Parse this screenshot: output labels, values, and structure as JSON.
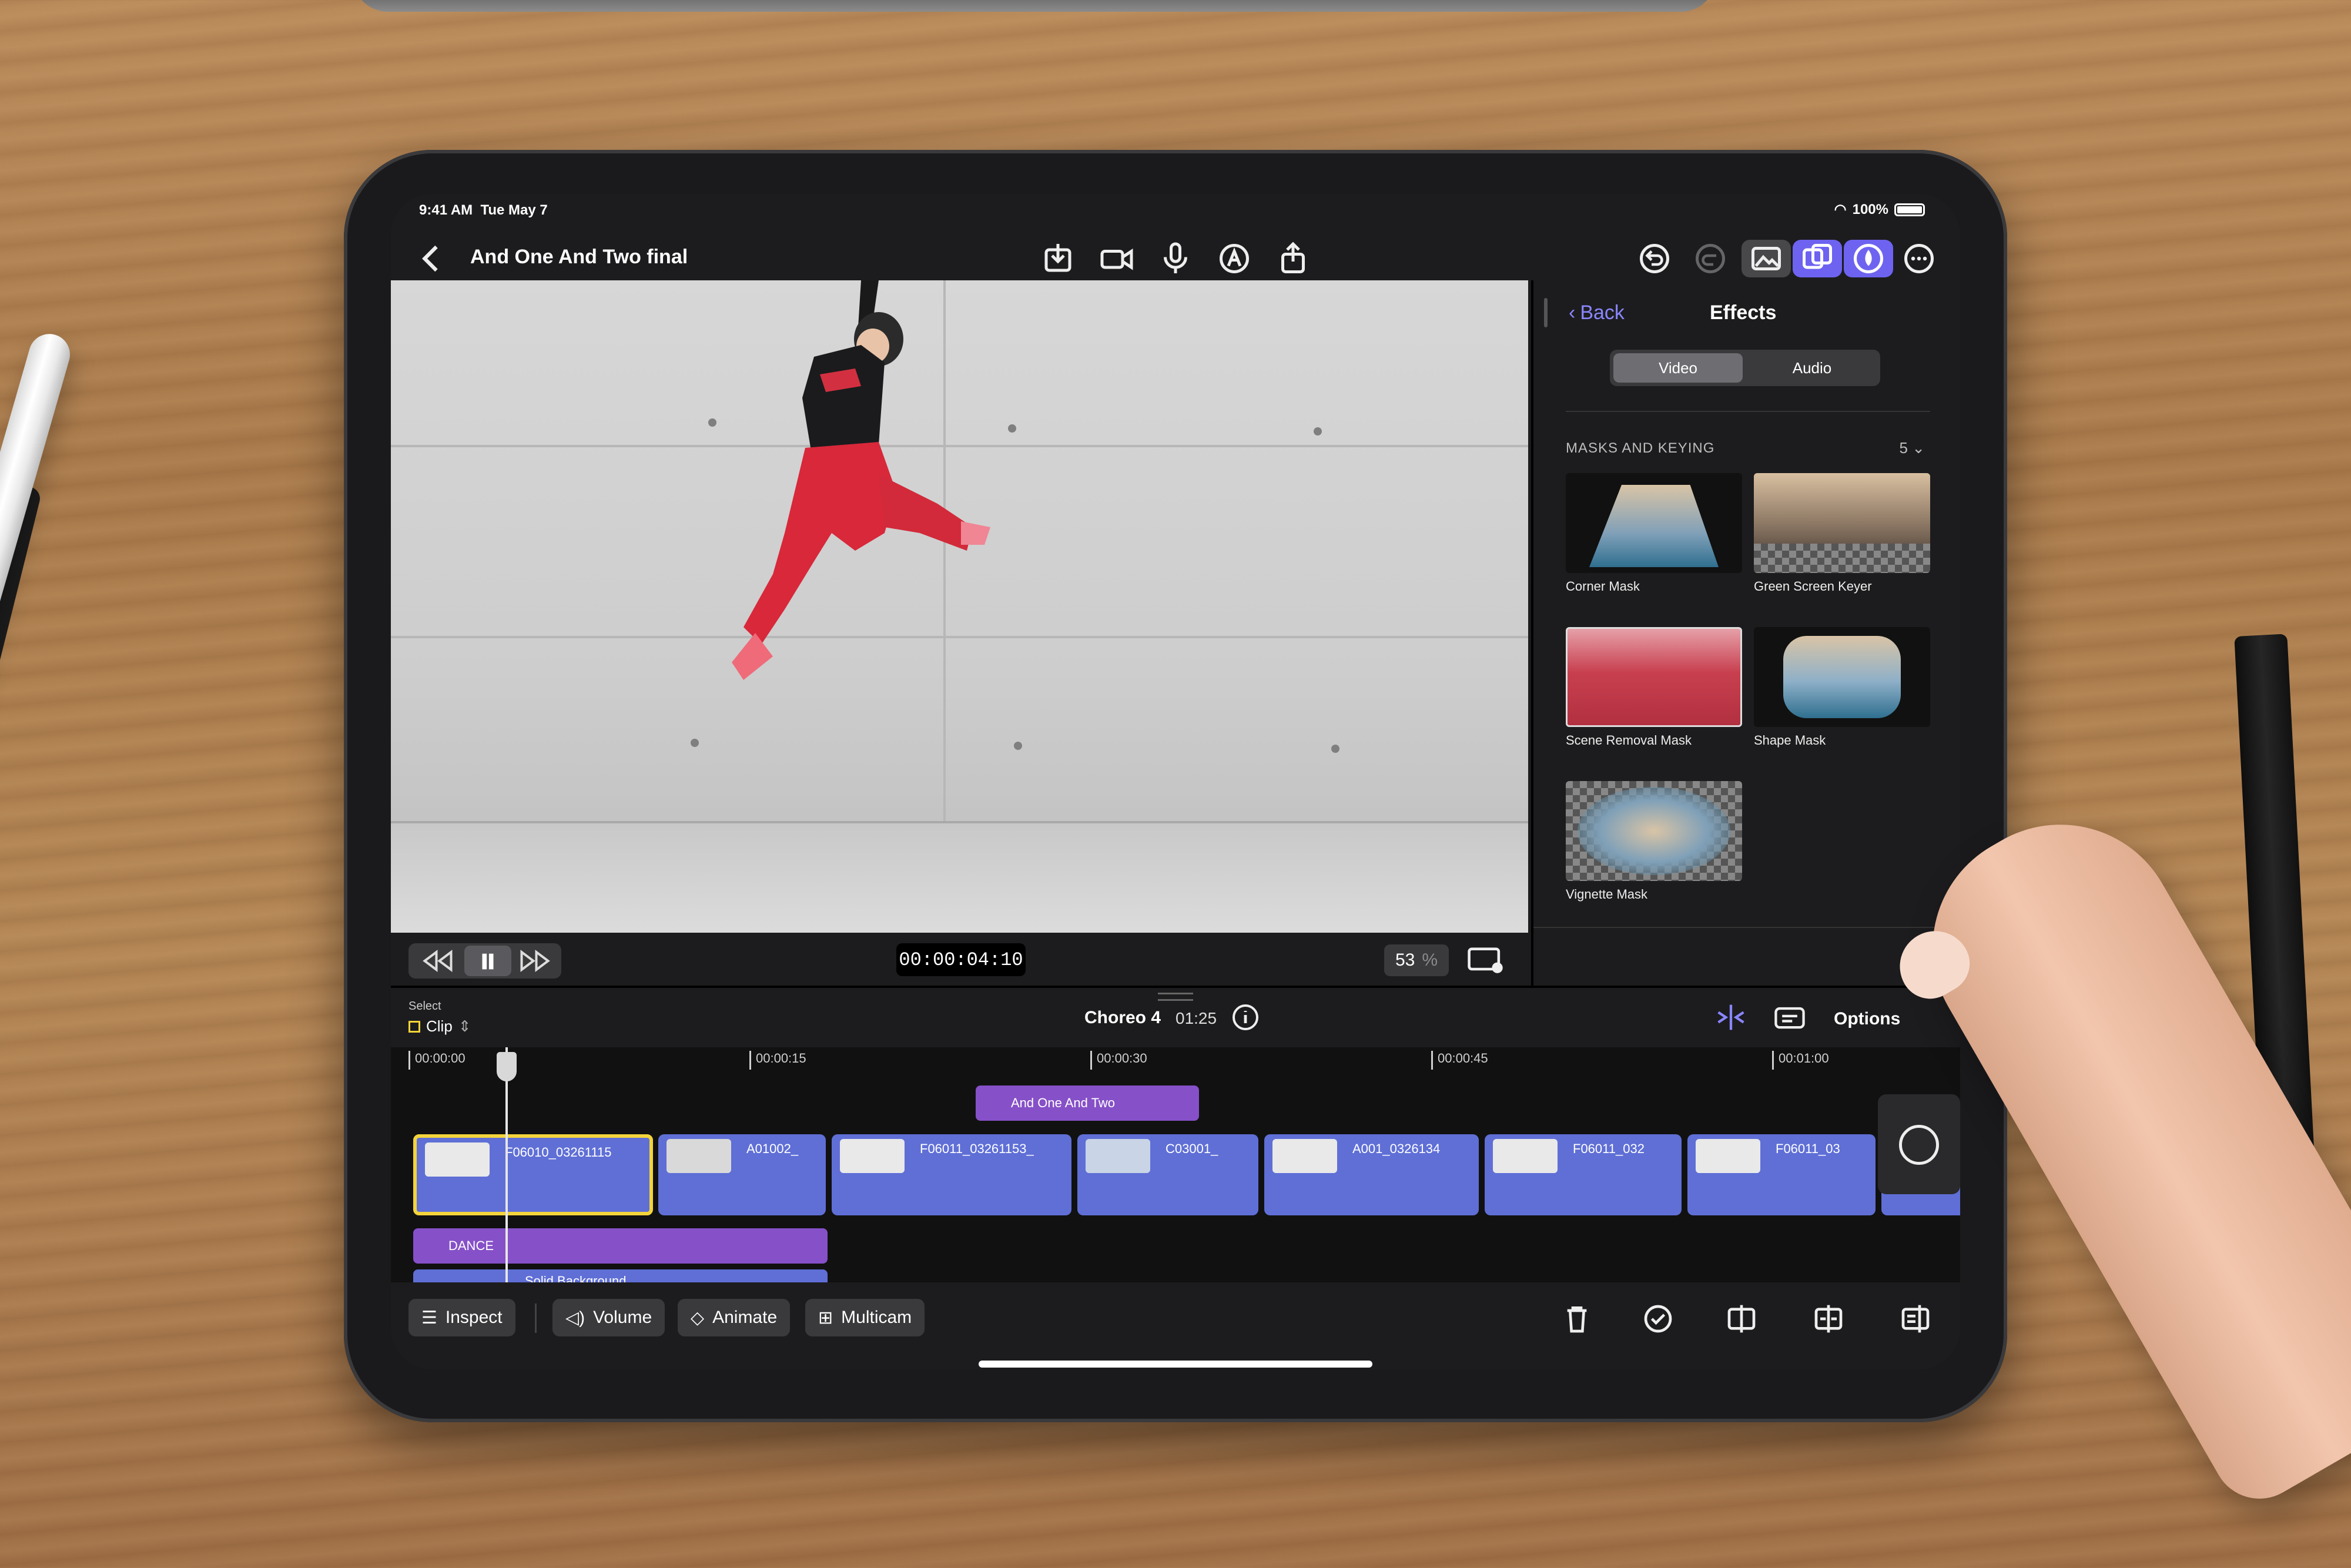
{
  "status": {
    "time": "9:41 AM",
    "date": "Tue May 7",
    "battery": "100%"
  },
  "toolbar": {
    "project_title": "And One And Two final",
    "icons": [
      "back-chevron-icon",
      "import-icon",
      "camera-icon",
      "microphone-icon",
      "voiceover-icon",
      "share-icon",
      "undo-icon",
      "redo-icon",
      "photo-browser-icon",
      "effects-browser-icon",
      "color-icon",
      "more-icon"
    ]
  },
  "player": {
    "timecode": "00:00:04:10",
    "zoom_value": "53",
    "zoom_unit": "%"
  },
  "effects_panel": {
    "back_label": "Back",
    "title": "Effects",
    "segments": [
      "Video",
      "Audio"
    ],
    "selected_segment": "Video",
    "section_header": "MASKS AND KEYING",
    "section_count": "5",
    "items": [
      {
        "label": "Corner Mask"
      },
      {
        "label": "Green Screen Keyer"
      },
      {
        "label": "Scene Removal Mask"
      },
      {
        "label": "Shape Mask"
      },
      {
        "label": "Vignette Mask"
      }
    ]
  },
  "timeline_header": {
    "select_label": "Select",
    "select_value": "Clip",
    "project_name": "Choreo 4",
    "duration": "01:25",
    "options_label": "Options"
  },
  "ruler": [
    "00:00:00",
    "00:00:15",
    "00:00:30",
    "00:00:45",
    "00:01:00"
  ],
  "title_clip": "And One And Two",
  "clips": [
    "F06010_03261115",
    "A01002_",
    "F06011_03261153_",
    "C03001_",
    "A001_0326134",
    "F06011_032",
    "F06011_03"
  ],
  "connected_clips": [
    "DANCE",
    "Solid Background"
  ],
  "bottom_buttons": [
    "Inspect",
    "Volume",
    "Animate",
    "Multicam"
  ],
  "colors": {
    "accent": "#8a86ff",
    "clip_blue": "#5f6fd6",
    "title_purple": "#8650c8",
    "selected_yellow": "#f3d43a"
  }
}
